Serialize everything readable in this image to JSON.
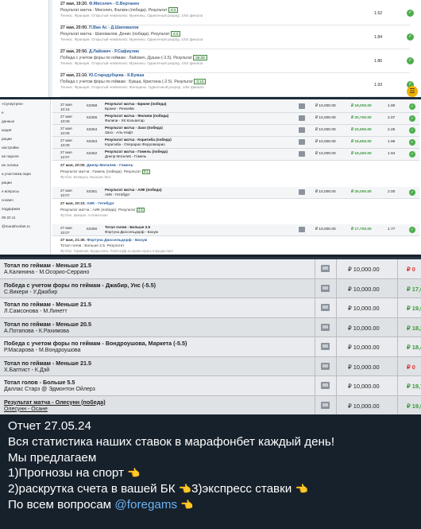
{
  "panel1": {
    "bets": [
      {
        "date": "27 мая, 19:20.",
        "teams": "Ф.Мисолич - О.Вертанен",
        "line": "Результат матча : Мисолич, Фалкин (победа). Результат",
        "score": "2:2",
        "sub": "Теннис. Франция. Открытый чемпионат. Мужчины. Одиночный разряд. 1/64 финала",
        "odd": "1.52"
      },
      {
        "date": "27 мая, 20:00.",
        "teams": "П.Ван Ас - Д.Шаповалов",
        "line": "Результат матча : Шаповалов, Денис (победа). Результат",
        "score": "2:3",
        "sub": "Теннис. Франция. Открытый чемпионат. Мужчины. Одиночный разряд. 1/64 финала",
        "odd": "1.84"
      },
      {
        "date": "27 мая, 20:50.",
        "teams": "Д.Лайович - Р.Сафиулин",
        "line": "Победа с учетом форы по геймам : Лайович, Душан (-2.5). Результат",
        "score": "26:26",
        "sub": "Теннис. Франция. Открытый чемпионат. Мужчины. Одиночный разряд. 1/64 финала",
        "odd": "1.86"
      },
      {
        "date": "27 мая, 21:10.",
        "teams": "Ю.Стародубцева - К.Букша",
        "line": "Победа с учетом форы по геймам : Букша, Кристина (-2.5). Результат",
        "score": "3:13",
        "sub": "Теннис. Франция. Открытый чемпионат. Женщины. Одиночный разряд. 1/64 финала",
        "odd": "1.93"
      }
    ]
  },
  "panel2": {
    "sidebar": [
      "«Супертрек»",
      "",
      "е",
      "данные",
      "кация",
      "",
      "рации",
      "",
      "настройки",
      "ие пароля",
      "ие логина",
      "а участника пари",
      "рации",
      "е вопросы",
      "снович",
      "",
      "поддержки",
      "09 20 11",
      "@marathonbet.ru"
    ],
    "rows": [
      {
        "date": "27 мая 10:15",
        "id": "63368",
        "market": "Результат матча - Брюне (победа)",
        "event": "Брюне - Ренхейм",
        "stake": "₽ 10,000.00",
        "win": "₽ 19,000.00",
        "odd": "1.90"
      },
      {
        "date": "27 мая 10:09",
        "id": "63365",
        "market": "Результат матча - Филипи (победа)",
        "event": "Филипи - ХК Кольвитар",
        "stake": "₽ 10,000.00",
        "win": "₽ 20,700.00",
        "odd": "2.07"
      },
      {
        "date": "27 мая 10:09",
        "id": "63364",
        "market": "Результат матча - Захо (победа)",
        "event": "Захо - Аль-Нафт",
        "stake": "₽ 10,000.00",
        "win": "₽ 22,500.00",
        "odd": "2.25"
      },
      {
        "date": "27 мая 10:09",
        "id": "63363",
        "market": "Результат матча - Коритиба (победа)",
        "event": "Коритиба - Операрио Ферровиарио",
        "stake": "₽ 10,000.00",
        "win": "₽ 19,600.00",
        "odd": "1.96"
      },
      {
        "date": "27 мая 12:07",
        "id": "63362",
        "market": "Результат матча - Гомель (победа)",
        "event": "Днепр Могилев - Гомель",
        "stake": "₽ 10,000.00",
        "win": "₽ 19,400.00",
        "odd": "1.94"
      }
    ],
    "text_blocks": [
      {
        "date": "27 мая, 20:00.",
        "teams": "Днепр Могилев - Гомель",
        "line": "Результат матча : Гомель (победа). Результат",
        "score": "0:1",
        "sub": "Футбол. Беларусь. Высшая лига"
      },
      {
        "date": "27 мая, 20:10.",
        "teams": "АИК - Гетебург",
        "line": "Результат матча : АИК (победа). Результат",
        "score": "2:1",
        "sub": "Футбол. Швеция. Аллсвенскан"
      },
      {
        "date": "27 мая, 21:30.",
        "teams": "Фортуна Дюссельдорф - Бохум",
        "line": "Тотал голов : Больше 2.5. Результат",
        "score": "",
        "sub": "Футбол. Германия. Бундеслига. Плей-офф за право играть в Бундеслиге"
      }
    ],
    "rows2": [
      {
        "date": "27 мая 10:07",
        "id": "63361",
        "market": "Результат матча - АИК (победа)",
        "event": "АИК - Гетебург",
        "stake": "₽ 10,000.00",
        "win": "₽ 20,000.00",
        "odd": "2.00"
      },
      {
        "date": "27 мая 10:07",
        "id": "63360",
        "market": "Тотал голов - Больше 2.5",
        "event": "Фортуна Дюссельдорф - Бохум",
        "stake": "₽ 10,000.00",
        "win": "₽ 17,700.00",
        "odd": "1.77"
      }
    ]
  },
  "panel3": {
    "rows": [
      {
        "title": "Тотал по геймам - Меньше 21.5",
        "players": "А.Калинина - М.Осорио-Серрано",
        "stake": "₽ 10,000.00",
        "win": "₽ 0",
        "status": "red"
      },
      {
        "title": "Победа с учетом форы по геймам - Джабир, Унс (-5.5)",
        "players": "С.Викери - У.Джабир",
        "stake": "₽ 10,000.00",
        "win": "₽ 17,6",
        "status": "green"
      },
      {
        "title": "Тотал по геймам - Меньше 21.5",
        "players": "Л.Самсонова - М.Линетт",
        "stake": "₽ 10,000.00",
        "win": "₽ 19,0",
        "status": "green"
      },
      {
        "title": "Тотал по геймам - Меньше 20.5",
        "players": "А.Потапова - К.Рахимова",
        "stake": "₽ 10,000.00",
        "win": "₽ 18,2",
        "status": "green"
      },
      {
        "title": "Победа с учетом форы по геймам - Вондроушова, Маркета (-5.5)",
        "players": "Р.Масарова - М.Вондроушова",
        "stake": "₽ 10,000.00",
        "win": "₽ 18,4",
        "status": "green"
      },
      {
        "title": "Тотал по геймам - Меньше 21.5",
        "players": "Х.Баптист - К.Дэй",
        "stake": "₽ 10,000.00",
        "win": "₽ 0",
        "status": "red"
      },
      {
        "title": "Тотал голов - Больше 5.5",
        "players": "Даллас Старз @ Эдмонтон Ойлерз",
        "stake": "₽ 10,000.00",
        "win": "₽ 19,7",
        "status": "green"
      },
      {
        "title": "Результат матча - Олесунн (победа)",
        "players": "Олесунн - Осане",
        "stake": "₽ 10,000.00",
        "win": "₽ 19,0",
        "status": "green",
        "underline": true
      }
    ]
  },
  "message": {
    "line1": "Отчет  27.05.24",
    "line2": "Вся статистика наших ставок в марафонбет каждый день!",
    "line3": "Мы предлагаем",
    "line4": "1)Прогнозы на спорт",
    "line5a": "2)раскрутка счета в вашей БК",
    "line5b": "3)экспресс ставки",
    "line6a": "По всем вопросам",
    "mention": "@foregams",
    "emoji": "👈"
  },
  "colors": {
    "chat_bg": "#17212b",
    "mention": "#6ab3f3",
    "win_green": "#3a9a3a",
    "lose_red": "#d33333"
  }
}
